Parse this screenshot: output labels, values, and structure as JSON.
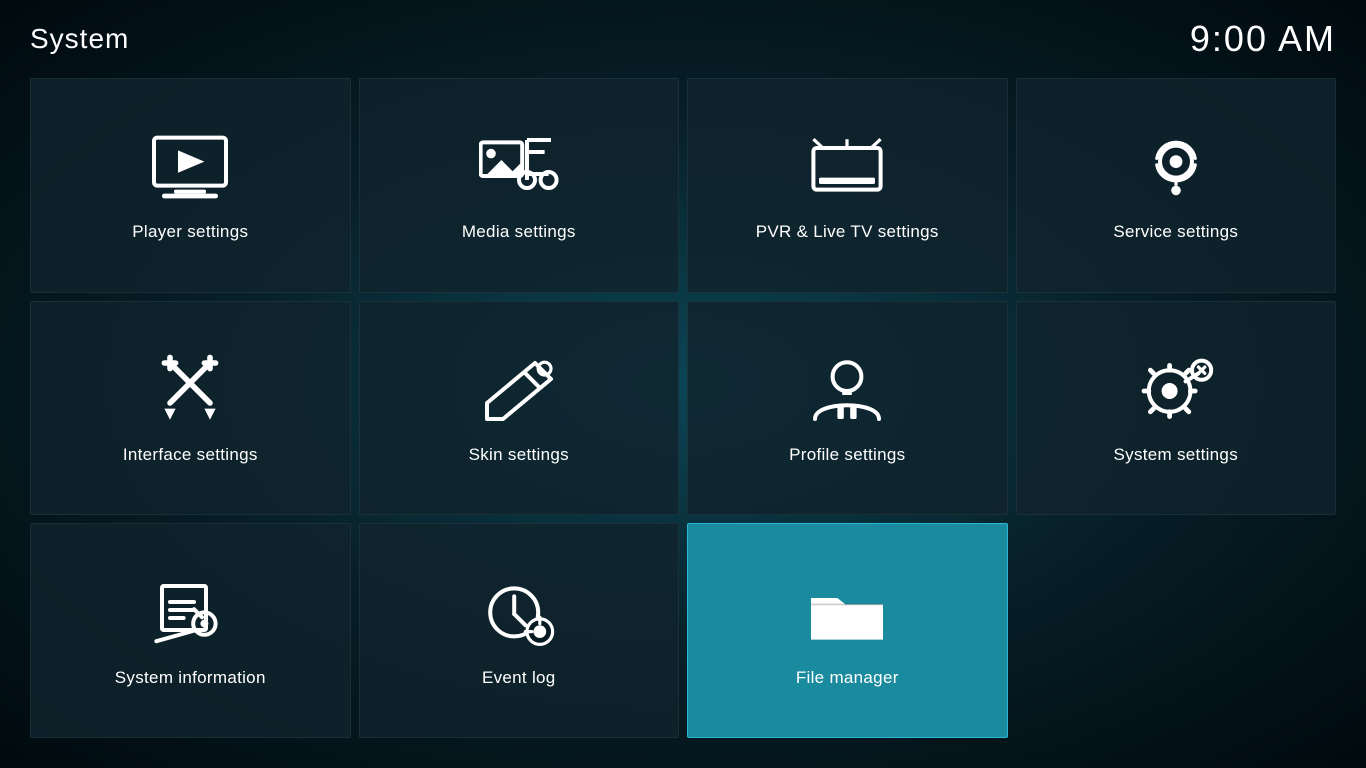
{
  "header": {
    "title": "System",
    "time": "9:00 AM"
  },
  "tiles": [
    {
      "id": "player-settings",
      "label": "Player settings",
      "icon": "player",
      "active": false
    },
    {
      "id": "media-settings",
      "label": "Media settings",
      "icon": "media",
      "active": false
    },
    {
      "id": "pvr-settings",
      "label": "PVR & Live TV settings",
      "icon": "pvr",
      "active": false
    },
    {
      "id": "service-settings",
      "label": "Service settings",
      "icon": "service",
      "active": false
    },
    {
      "id": "interface-settings",
      "label": "Interface settings",
      "icon": "interface",
      "active": false
    },
    {
      "id": "skin-settings",
      "label": "Skin settings",
      "icon": "skin",
      "active": false
    },
    {
      "id": "profile-settings",
      "label": "Profile settings",
      "icon": "profile",
      "active": false
    },
    {
      "id": "system-settings",
      "label": "System settings",
      "icon": "systemsettings",
      "active": false
    },
    {
      "id": "system-information",
      "label": "System information",
      "icon": "sysinfo",
      "active": false
    },
    {
      "id": "event-log",
      "label": "Event log",
      "icon": "eventlog",
      "active": false
    },
    {
      "id": "file-manager",
      "label": "File manager",
      "icon": "filemanager",
      "active": true
    }
  ]
}
